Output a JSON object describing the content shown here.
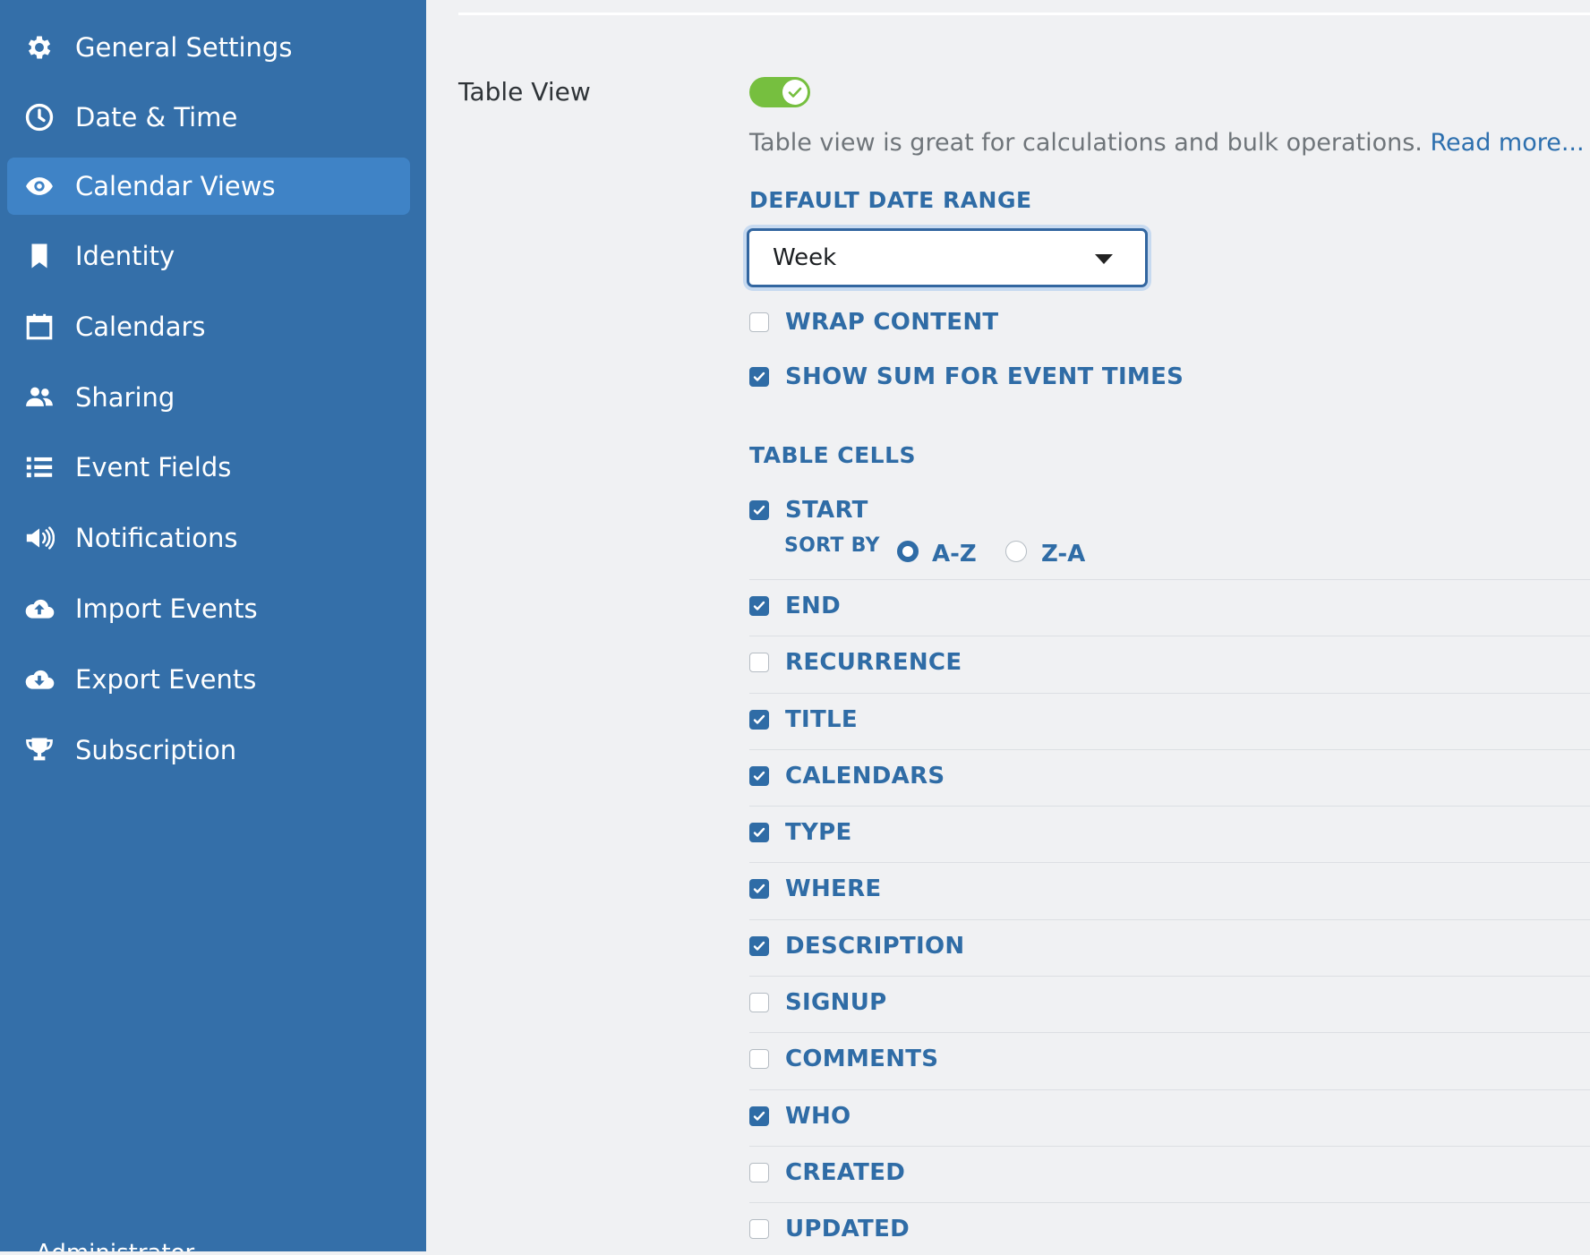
{
  "sidebar": {
    "items": [
      {
        "label": "General Settings",
        "icon": "gear-icon",
        "active": false
      },
      {
        "label": "Date & Time",
        "icon": "clock-icon",
        "active": false
      },
      {
        "label": "Calendar Views",
        "icon": "eye-icon",
        "active": true
      },
      {
        "label": "Identity",
        "icon": "bookmark-icon",
        "active": false
      },
      {
        "label": "Calendars",
        "icon": "calendar-icon",
        "active": false
      },
      {
        "label": "Sharing",
        "icon": "users-icon",
        "active": false
      },
      {
        "label": "Event Fields",
        "icon": "list-icon",
        "active": false
      },
      {
        "label": "Notifications",
        "icon": "megaphone-icon",
        "active": false
      },
      {
        "label": "Import Events",
        "icon": "cloud-upload-icon",
        "active": false
      },
      {
        "label": "Export Events",
        "icon": "cloud-download-icon",
        "active": false
      },
      {
        "label": "Subscription",
        "icon": "trophy-icon",
        "active": false
      }
    ],
    "more_label": "Administrator"
  },
  "main": {
    "setting_label": "Table View",
    "toggle_on": true,
    "description": "Table view is great for calculations and bulk operations.",
    "read_more": "Read more...",
    "date_range_heading": "DEFAULT DATE RANGE",
    "date_range_value": "Week",
    "wrap_content": {
      "label": "WRAP CONTENT",
      "checked": false
    },
    "show_sum": {
      "label": "SHOW SUM FOR EVENT TIMES",
      "checked": true
    },
    "table_cells_heading": "TABLE CELLS",
    "sort_by_label": "SORT BY",
    "sort_options": [
      {
        "label": "A-Z",
        "selected": true
      },
      {
        "label": "Z-A",
        "selected": false
      }
    ],
    "cells": [
      {
        "label": "START",
        "checked": true
      },
      {
        "label": "END",
        "checked": true
      },
      {
        "label": "RECURRENCE",
        "checked": false
      },
      {
        "label": "TITLE",
        "checked": true
      },
      {
        "label": "CALENDARS",
        "checked": true
      },
      {
        "label": "TYPE",
        "checked": true
      },
      {
        "label": "WHERE",
        "checked": true
      },
      {
        "label": "DESCRIPTION",
        "checked": true
      },
      {
        "label": "SIGNUP",
        "checked": false
      },
      {
        "label": "COMMENTS",
        "checked": false
      },
      {
        "label": "WHO",
        "checked": true
      },
      {
        "label": "CREATED",
        "checked": false
      },
      {
        "label": "UPDATED",
        "checked": false
      }
    ]
  },
  "colors": {
    "sidebar": "#346fa9",
    "sidebar_active": "#3f83c6",
    "accent": "#2f6ca6",
    "toggle": "#76bf3f"
  }
}
